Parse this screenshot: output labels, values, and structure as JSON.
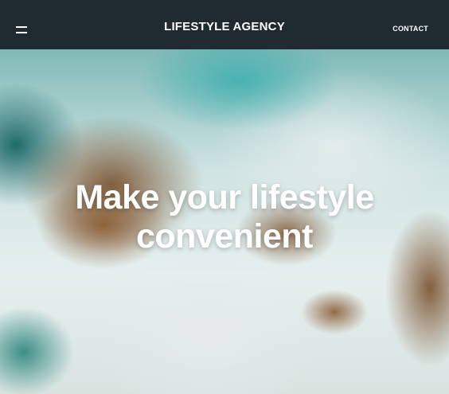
{
  "header": {
    "brand": "LIFESTYLE AGENCY",
    "contact_label": "CONTACT",
    "menu_icon": "menu-icon"
  },
  "hero": {
    "headline": "Make your lifestyle convenient",
    "background": "aerial-ocean-rocks-photo"
  },
  "colors": {
    "header_bg": "#1f2b31",
    "text": "#ffffff"
  }
}
